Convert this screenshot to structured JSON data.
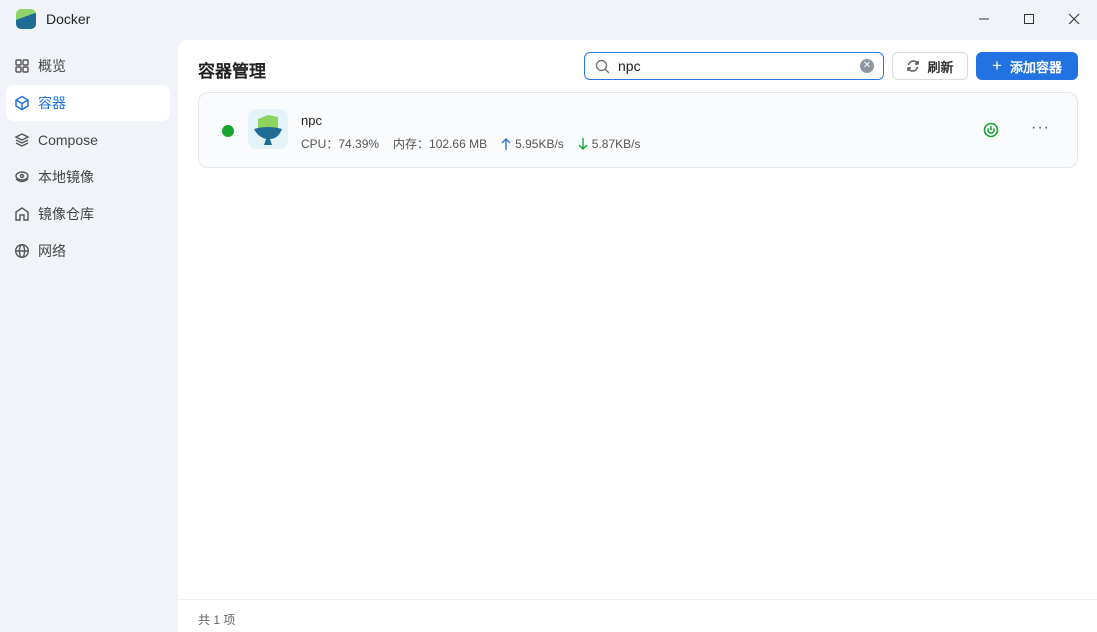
{
  "app": {
    "title": "Docker"
  },
  "sidebar": {
    "items": [
      {
        "label": "概览",
        "icon": "grid-icon"
      },
      {
        "label": "容器",
        "icon": "cube-icon",
        "active": true
      },
      {
        "label": "Compose",
        "icon": "layers-icon"
      },
      {
        "label": "本地镜像",
        "icon": "disk-icon"
      },
      {
        "label": "镜像仓库",
        "icon": "home-icon"
      },
      {
        "label": "网络",
        "icon": "globe-icon"
      }
    ]
  },
  "main": {
    "title": "容器管理",
    "search": {
      "value": "npc",
      "placeholder": ""
    },
    "refresh_label": "刷新",
    "add_label": "添加容器",
    "containers": [
      {
        "name": "npc",
        "status": "running",
        "cpu": "CPU：74.39%",
        "memory": "内存：102.66 MB",
        "upload": "5.95KB/s",
        "download": "5.87KB/s"
      }
    ],
    "footer": "共 1 项"
  },
  "colors": {
    "accent": "#2273e1",
    "running": "#17a532"
  }
}
